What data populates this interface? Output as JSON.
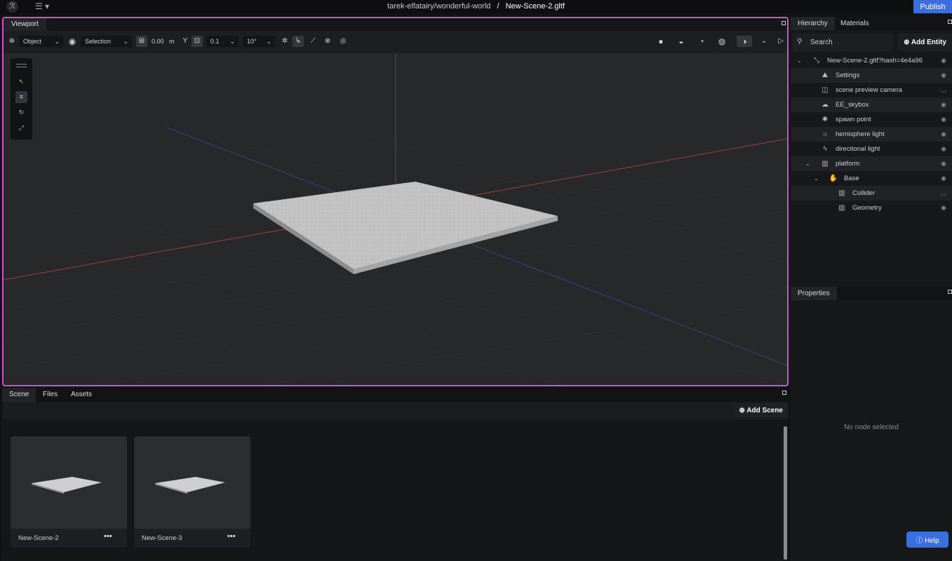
{
  "topbar": {
    "logo_glyph": "ℛ",
    "menu_glyph": "☰ ▾",
    "project_path": "tarek-elfatairy/wonderful-world",
    "separator": "/",
    "scene_file": "New-Scene-2.gltf",
    "publish_label": "Publish"
  },
  "viewport": {
    "tab_label": "Viewport",
    "toolbar": {
      "transform_space": "Object",
      "pivot_mode": "Selection",
      "grid_height": "0.00",
      "grid_unit": "m",
      "translation_snap": "0.1",
      "rotation_snap": "10°"
    }
  },
  "hierarchy": {
    "tab_label": "Hierarchy",
    "materials_tab_label": "Materials",
    "search_placeholder": "Search",
    "add_entity_label": "Add Entity",
    "nodes": [
      {
        "label": "New-Scene-2.gltf?hash=4e4a96",
        "icon": "transform-icon",
        "glyph": "⤡",
        "depth": 0,
        "expanded": true,
        "visible": true
      },
      {
        "label": "Settings",
        "icon": "settings-icon",
        "glyph": "⛰",
        "depth": 1,
        "visible": true
      },
      {
        "label": "scene preview camera",
        "icon": "camera-icon",
        "glyph": "◫",
        "depth": 1,
        "visible": false
      },
      {
        "label": "EE_skybox",
        "icon": "cloud-icon",
        "glyph": "☁",
        "depth": 1,
        "visible": true
      },
      {
        "label": "spawn point",
        "icon": "spawn-icon",
        "glyph": "✺",
        "depth": 1,
        "visible": true
      },
      {
        "label": "hemisphere light",
        "icon": "hemisphere-light-icon",
        "glyph": "☼",
        "depth": 1,
        "visible": true
      },
      {
        "label": "directional light",
        "icon": "bolt-icon",
        "glyph": "ϟ",
        "depth": 1,
        "visible": true
      },
      {
        "label": "platform",
        "icon": "map-icon",
        "glyph": "▥",
        "depth": 1,
        "expanded": true,
        "visible": true
      },
      {
        "label": "Base",
        "icon": "hand-icon",
        "glyph": "✋",
        "depth": 2,
        "expanded": true,
        "visible": true
      },
      {
        "label": "Collider",
        "icon": "map-icon",
        "glyph": "▥",
        "depth": 3,
        "visible": false
      },
      {
        "label": "Geometry",
        "icon": "map-icon",
        "glyph": "▥",
        "depth": 3,
        "visible": true
      }
    ]
  },
  "properties": {
    "tab_label": "Properties",
    "empty_text": "No node selected"
  },
  "bottom": {
    "tabs": [
      "Scene",
      "Files",
      "Assets"
    ],
    "add_scene_label": "Add Scene",
    "scenes": [
      {
        "name": "New-Scene-2",
        "menu": "•••"
      },
      {
        "name": "New-Scene-3",
        "menu": "•••"
      }
    ]
  },
  "help_label": "Help",
  "colors": {
    "accent": "#3b6fe0",
    "viewport_border": "#d64ddc",
    "grid_x_axis": "#b5453a",
    "grid_z_axis": "#3b3f8f",
    "grid_y_axis": "#2f5f4f"
  }
}
